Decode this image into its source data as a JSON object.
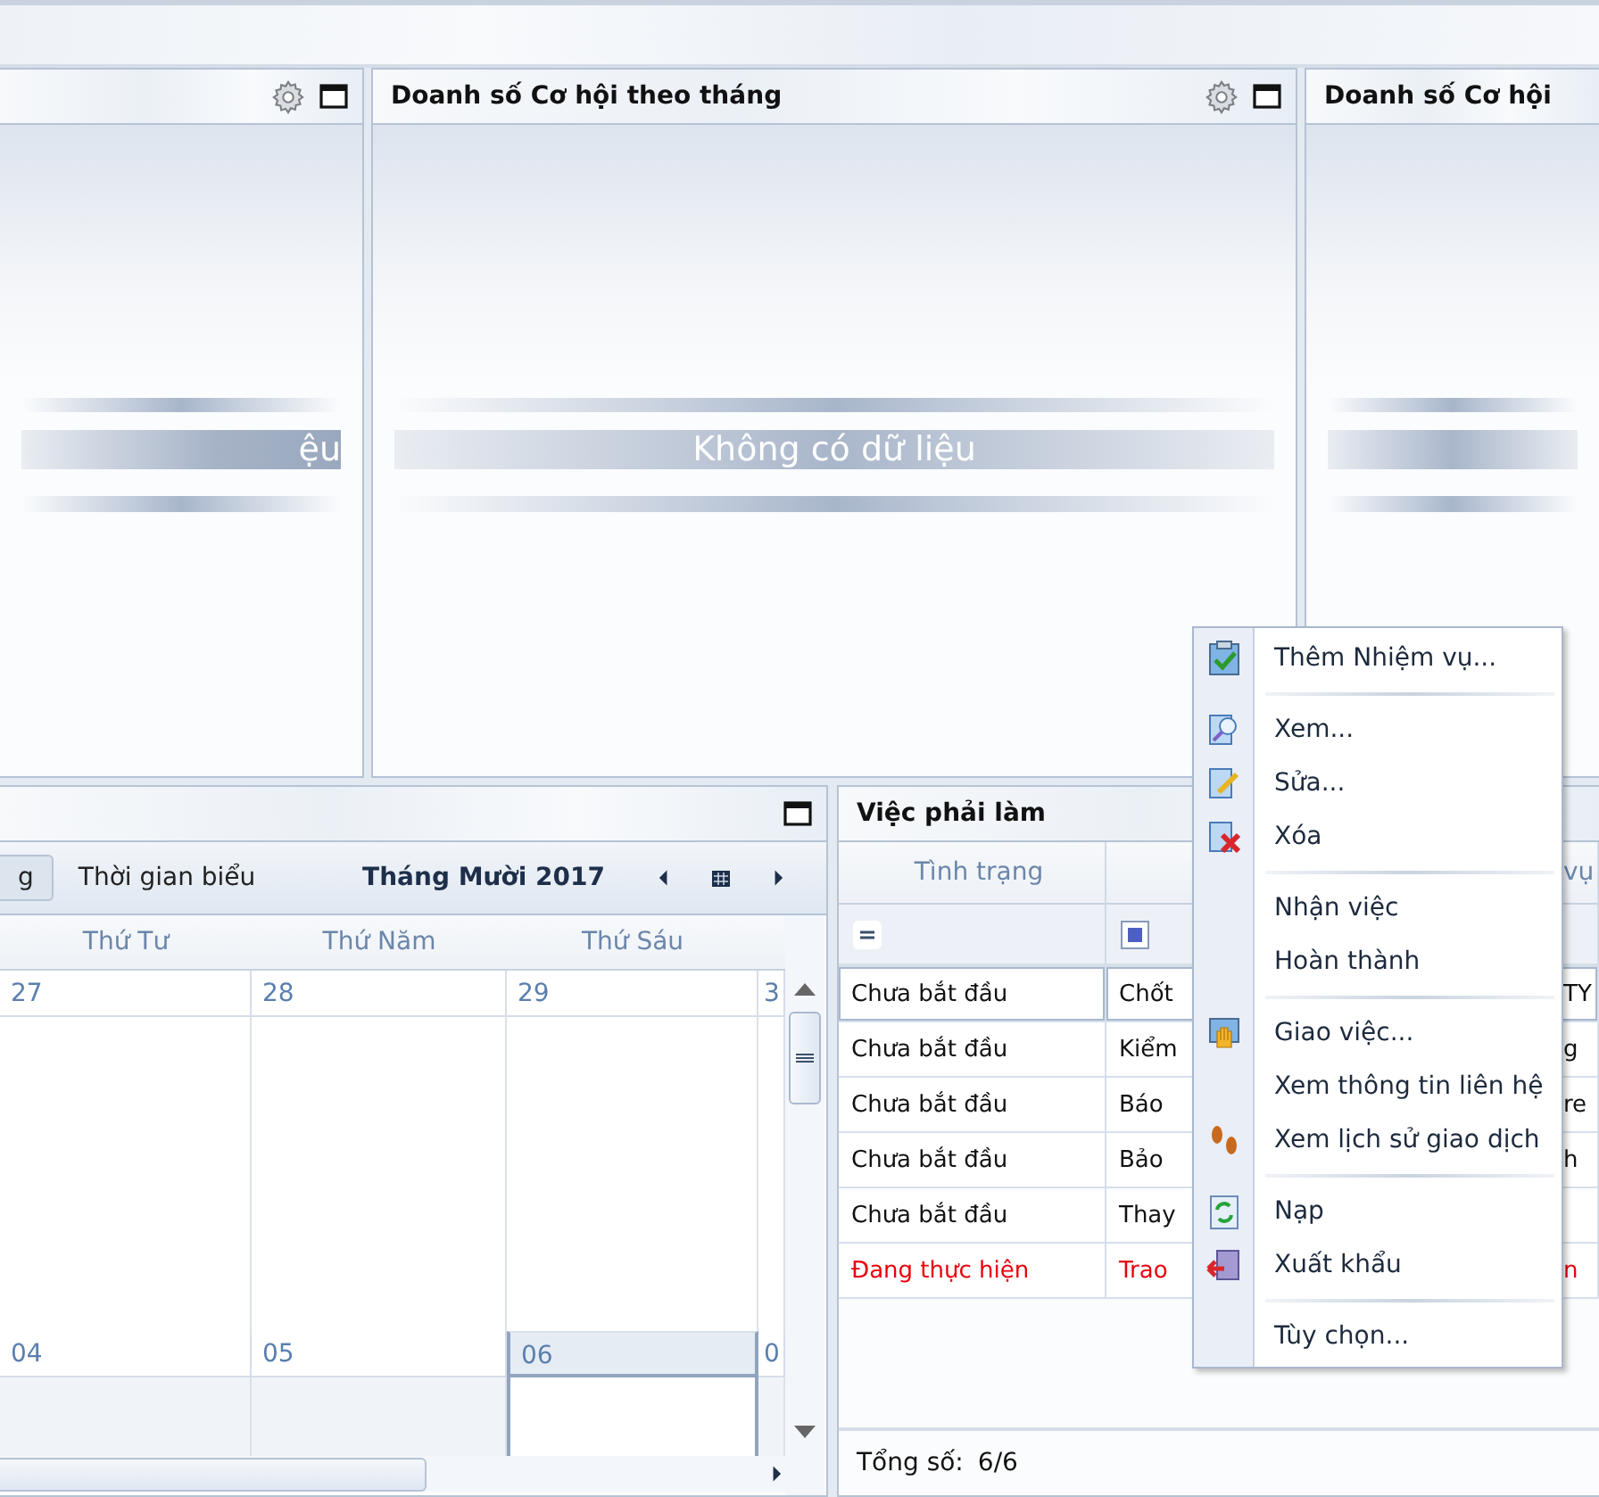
{
  "chart_panels": [
    {
      "message": "ệu",
      "tools": true
    },
    {
      "title": "Doanh số Cơ hội theo tháng",
      "message": "Không có dữ liệu",
      "tools": true
    },
    {
      "title": "Doanh số Cơ hội",
      "tools": false
    }
  ],
  "calendar": {
    "views": [
      {
        "label": "g",
        "selected": true
      },
      {
        "label": "Thời gian biểu",
        "selected": false
      }
    ],
    "month": "Tháng Mười 2017",
    "days": [
      "Thứ Tư",
      "Thứ Năm",
      "Thứ Sáu"
    ],
    "weeks": [
      {
        "dates": [
          {
            "label": "27",
            "selected": false
          },
          {
            "label": "28",
            "selected": false
          },
          {
            "label": "29",
            "selected": false
          },
          {
            "label": "3",
            "selected": false
          }
        ]
      },
      {
        "dates": [
          {
            "label": "04",
            "selected": false
          },
          {
            "label": "05",
            "selected": false
          },
          {
            "label": "06",
            "selected": true
          },
          {
            "label": "0",
            "selected": false
          }
        ]
      }
    ]
  },
  "todo": {
    "title": "Việc phải làm",
    "columns": [
      "Tình trạng",
      "",
      "vụ"
    ],
    "rows": [
      {
        "cells": [
          "Chưa bắt đầu",
          "Chốt",
          "TY"
        ],
        "selected": true,
        "alert": false
      },
      {
        "cells": [
          "Chưa bắt đầu",
          "Kiểm",
          "g"
        ],
        "selected": false,
        "alert": false
      },
      {
        "cells": [
          "Chưa bắt đầu",
          "Báo",
          "re"
        ],
        "selected": false,
        "alert": false
      },
      {
        "cells": [
          "Chưa bắt đầu",
          "Bảo",
          "h"
        ],
        "selected": false,
        "alert": false
      },
      {
        "cells": [
          "Chưa bắt đầu",
          "Thay",
          ""
        ],
        "selected": false,
        "alert": false
      },
      {
        "cells": [
          "Đang thực hiện",
          "Trao",
          "n"
        ],
        "selected": false,
        "alert": true
      }
    ],
    "total_label": "Tổng số:",
    "total": "6/6"
  },
  "context_menu": {
    "groups": [
      [
        {
          "label": "Thêm Nhiệm vụ...",
          "has_icon": true
        }
      ],
      [
        {
          "label": "Xem...",
          "has_icon": true
        },
        {
          "label": "Sửa...",
          "has_icon": true
        },
        {
          "label": "Xóa",
          "has_icon": true
        }
      ],
      [
        {
          "label": "Nhận việc",
          "has_icon": false
        },
        {
          "label": "Hoàn thành",
          "has_icon": false
        }
      ],
      [
        {
          "label": "Giao việc...",
          "has_icon": true
        },
        {
          "label": "Xem thông tin liên hệ",
          "has_icon": false
        },
        {
          "label": "Xem lịch sử giao dịch",
          "has_icon": true
        }
      ],
      [
        {
          "label": "Nạp",
          "has_icon": true
        },
        {
          "label": "Xuất khẩu",
          "has_icon": true
        }
      ],
      [
        {
          "label": "Tùy chọn...",
          "has_icon": false
        }
      ]
    ]
  }
}
